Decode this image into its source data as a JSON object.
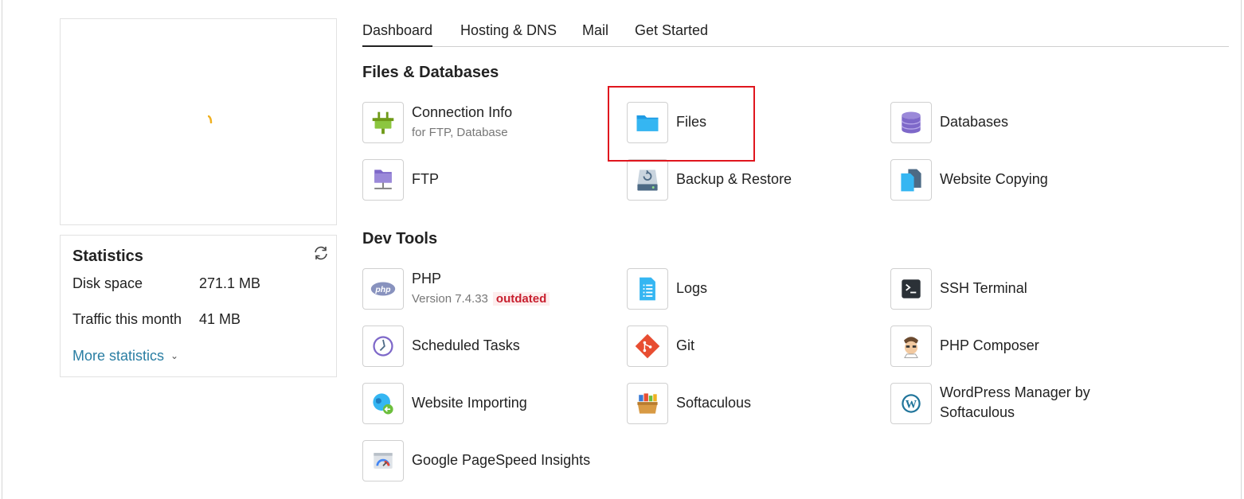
{
  "tabs": [
    {
      "label": "Dashboard",
      "active": true
    },
    {
      "label": "Hosting & DNS",
      "active": false
    },
    {
      "label": "Mail",
      "active": false
    },
    {
      "label": "Get Started",
      "active": false
    }
  ],
  "statistics": {
    "title": "Statistics",
    "rows": [
      {
        "label": "Disk space",
        "value": "271.1 MB"
      },
      {
        "label": "Traffic this month",
        "value": "41 MB"
      }
    ],
    "more_label": "More statistics"
  },
  "sections": {
    "files": {
      "title": "Files & Databases",
      "items": {
        "connection": {
          "title": "Connection Info",
          "sub": "for FTP, Database",
          "icon": "plug-icon"
        },
        "files": {
          "title": "Files",
          "icon": "folder-icon"
        },
        "databases": {
          "title": "Databases",
          "icon": "database-icon"
        },
        "ftp": {
          "title": "FTP",
          "icon": "ftp-folder-icon"
        },
        "backup": {
          "title": "Backup & Restore",
          "icon": "backup-drive-icon"
        },
        "copying": {
          "title": "Website Copying",
          "icon": "copy-document-icon"
        }
      }
    },
    "dev": {
      "title": "Dev Tools",
      "items": {
        "php": {
          "title": "PHP",
          "sub": "Version 7.4.33",
          "badge": "outdated",
          "icon": "php-icon"
        },
        "logs": {
          "title": "Logs",
          "icon": "log-document-icon"
        },
        "ssh": {
          "title": "SSH Terminal",
          "icon": "terminal-icon"
        },
        "tasks": {
          "title": "Scheduled Tasks",
          "icon": "clock-icon"
        },
        "git": {
          "title": "Git",
          "icon": "git-icon"
        },
        "composer": {
          "title": "PHP Composer",
          "icon": "composer-icon"
        },
        "importing": {
          "title": "Website Importing",
          "icon": "globe-import-icon"
        },
        "softaculous": {
          "title": "Softaculous",
          "icon": "softaculous-icon"
        },
        "wordpress": {
          "title": "WordPress Manager by",
          "title2": "Softaculous",
          "icon": "wordpress-icon"
        },
        "pagespeed": {
          "title": "Google PageSpeed Insights",
          "icon": "speedometer-icon"
        }
      }
    }
  },
  "colors": {
    "accent": "#2a7ea3",
    "highlight": "#e0161e",
    "badge_text": "#c8202f"
  }
}
